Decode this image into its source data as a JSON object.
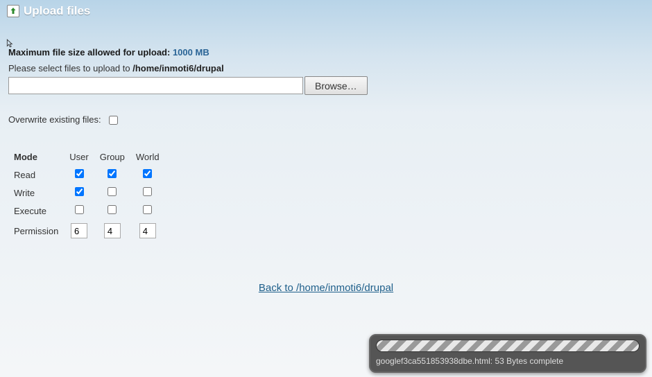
{
  "header": {
    "title": "Upload files"
  },
  "max_size": {
    "label": "Maximum file size allowed for upload:",
    "value": "1000 MB"
  },
  "select_files": {
    "prefix": "Please select files to upload to",
    "path": "/home/inmoti6/drupal"
  },
  "file_input": {
    "value": ""
  },
  "browse_label": "Browse…",
  "overwrite": {
    "label": "Overwrite existing files:",
    "checked": false
  },
  "perm_table": {
    "headers": {
      "mode": "Mode",
      "user": "User",
      "group": "Group",
      "world": "World"
    },
    "rows": {
      "read": {
        "label": "Read",
        "user": true,
        "group": true,
        "world": true
      },
      "write": {
        "label": "Write",
        "user": true,
        "group": false,
        "world": false
      },
      "execute": {
        "label": "Execute",
        "user": false,
        "group": false,
        "world": false
      }
    },
    "permission": {
      "label": "Permission",
      "user": "6",
      "group": "4",
      "world": "4"
    }
  },
  "back_link": {
    "label": "Back to /home/inmoti6/drupal"
  },
  "status": {
    "text": "googlef3ca551853938dbe.html: 53 Bytes complete"
  }
}
